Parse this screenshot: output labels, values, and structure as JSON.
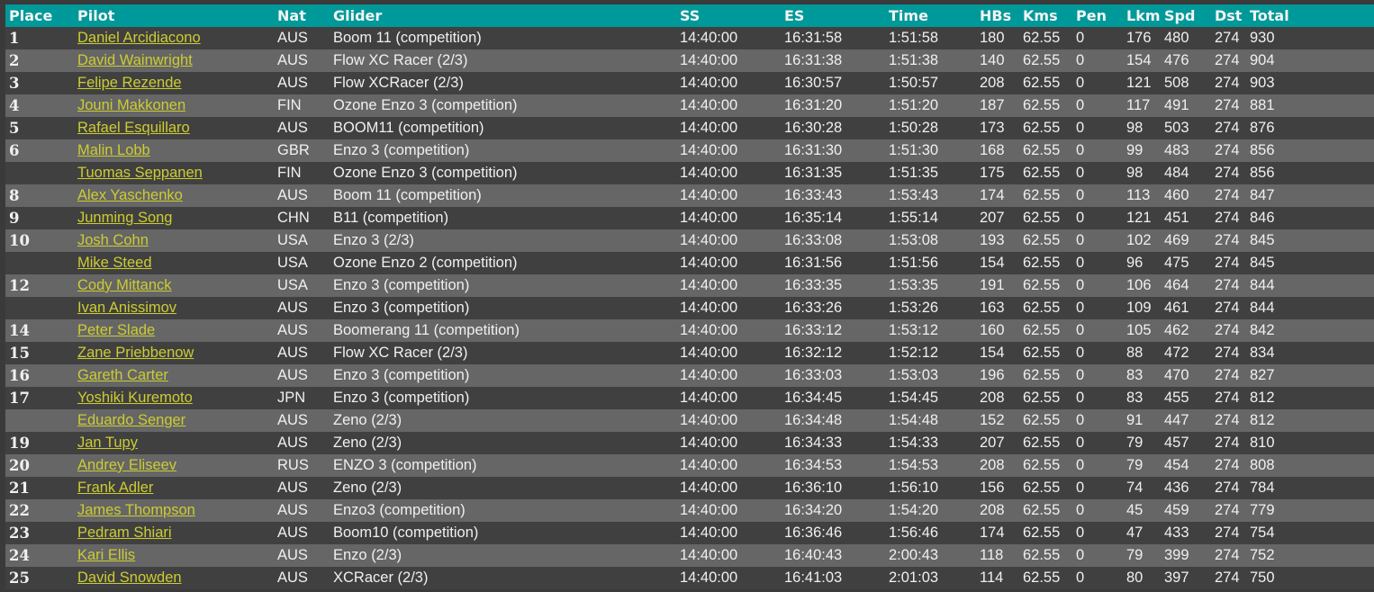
{
  "colors": {
    "header_bg": "#009999",
    "row_dark": "#404040",
    "row_light": "#666666",
    "link": "#cccc33",
    "text": "#f0f0f0"
  },
  "columns": [
    "Place",
    "Pilot",
    "Nat",
    "Glider",
    "SS",
    "ES",
    "Time",
    "HBs",
    "Kms",
    "Pen",
    "Lkm",
    "Spd",
    "Dst",
    "Total"
  ],
  "rows": [
    {
      "place": "1",
      "pilot": "Daniel Arcidiacono",
      "nat": "AUS",
      "glider": "Boom 11 (competition)",
      "ss": "14:40:00",
      "es": "16:31:58",
      "time": "1:51:58",
      "hbs": "180",
      "kms": "62.55",
      "pen": "0",
      "lkm": "176",
      "spd": "480",
      "dst": "274",
      "total": "930"
    },
    {
      "place": "2",
      "pilot": "David Wainwright",
      "nat": "AUS",
      "glider": "Flow XC Racer (2/3)",
      "ss": "14:40:00",
      "es": "16:31:38",
      "time": "1:51:38",
      "hbs": "140",
      "kms": "62.55",
      "pen": "0",
      "lkm": "154",
      "spd": "476",
      "dst": "274",
      "total": "904"
    },
    {
      "place": "3",
      "pilot": "Felipe Rezende",
      "nat": "AUS",
      "glider": "Flow XCRacer (2/3)",
      "ss": "14:40:00",
      "es": "16:30:57",
      "time": "1:50:57",
      "hbs": "208",
      "kms": "62.55",
      "pen": "0",
      "lkm": "121",
      "spd": "508",
      "dst": "274",
      "total": "903"
    },
    {
      "place": "4",
      "pilot": "Jouni Makkonen",
      "nat": "FIN",
      "glider": "Ozone Enzo 3 (competition)",
      "ss": "14:40:00",
      "es": "16:31:20",
      "time": "1:51:20",
      "hbs": "187",
      "kms": "62.55",
      "pen": "0",
      "lkm": "117",
      "spd": "491",
      "dst": "274",
      "total": "881"
    },
    {
      "place": "5",
      "pilot": "Rafael Esquillaro",
      "nat": "AUS",
      "glider": "BOOM11 (competition)",
      "ss": "14:40:00",
      "es": "16:30:28",
      "time": "1:50:28",
      "hbs": "173",
      "kms": "62.55",
      "pen": "0",
      "lkm": "98",
      "spd": "503",
      "dst": "274",
      "total": "876"
    },
    {
      "place": "6",
      "pilot": "Malin Lobb",
      "nat": "GBR",
      "glider": "Enzo 3 (competition)",
      "ss": "14:40:00",
      "es": "16:31:30",
      "time": "1:51:30",
      "hbs": "168",
      "kms": "62.55",
      "pen": "0",
      "lkm": "99",
      "spd": "483",
      "dst": "274",
      "total": "856"
    },
    {
      "place": "",
      "pilot": "Tuomas Seppanen",
      "nat": "FIN",
      "glider": "Ozone Enzo 3 (competition)",
      "ss": "14:40:00",
      "es": "16:31:35",
      "time": "1:51:35",
      "hbs": "175",
      "kms": "62.55",
      "pen": "0",
      "lkm": "98",
      "spd": "484",
      "dst": "274",
      "total": "856"
    },
    {
      "place": "8",
      "pilot": "Alex Yaschenko",
      "nat": "AUS",
      "glider": "Boom 11 (competition)",
      "ss": "14:40:00",
      "es": "16:33:43",
      "time": "1:53:43",
      "hbs": "174",
      "kms": "62.55",
      "pen": "0",
      "lkm": "113",
      "spd": "460",
      "dst": "274",
      "total": "847"
    },
    {
      "place": "9",
      "pilot": "Junming Song",
      "nat": "CHN",
      "glider": "B11 (competition)",
      "ss": "14:40:00",
      "es": "16:35:14",
      "time": "1:55:14",
      "hbs": "207",
      "kms": "62.55",
      "pen": "0",
      "lkm": "121",
      "spd": "451",
      "dst": "274",
      "total": "846"
    },
    {
      "place": "10",
      "pilot": "Josh Cohn",
      "nat": "USA",
      "glider": "Enzo 3 (2/3)",
      "ss": "14:40:00",
      "es": "16:33:08",
      "time": "1:53:08",
      "hbs": "193",
      "kms": "62.55",
      "pen": "0",
      "lkm": "102",
      "spd": "469",
      "dst": "274",
      "total": "845"
    },
    {
      "place": "",
      "pilot": "Mike Steed",
      "nat": "USA",
      "glider": "Ozone Enzo 2 (competition)",
      "ss": "14:40:00",
      "es": "16:31:56",
      "time": "1:51:56",
      "hbs": "154",
      "kms": "62.55",
      "pen": "0",
      "lkm": "96",
      "spd": "475",
      "dst": "274",
      "total": "845"
    },
    {
      "place": "12",
      "pilot": "Cody Mittanck",
      "nat": "USA",
      "glider": "Enzo 3 (competition)",
      "ss": "14:40:00",
      "es": "16:33:35",
      "time": "1:53:35",
      "hbs": "191",
      "kms": "62.55",
      "pen": "0",
      "lkm": "106",
      "spd": "464",
      "dst": "274",
      "total": "844"
    },
    {
      "place": "",
      "pilot": "Ivan Anissimov",
      "nat": "AUS",
      "glider": "Enzo 3 (competition)",
      "ss": "14:40:00",
      "es": "16:33:26",
      "time": "1:53:26",
      "hbs": "163",
      "kms": "62.55",
      "pen": "0",
      "lkm": "109",
      "spd": "461",
      "dst": "274",
      "total": "844"
    },
    {
      "place": "14",
      "pilot": "Peter Slade",
      "nat": "AUS",
      "glider": "Boomerang 11 (competition)",
      "ss": "14:40:00",
      "es": "16:33:12",
      "time": "1:53:12",
      "hbs": "160",
      "kms": "62.55",
      "pen": "0",
      "lkm": "105",
      "spd": "462",
      "dst": "274",
      "total": "842"
    },
    {
      "place": "15",
      "pilot": "Zane Priebbenow",
      "nat": "AUS",
      "glider": "Flow XC Racer (2/3)",
      "ss": "14:40:00",
      "es": "16:32:12",
      "time": "1:52:12",
      "hbs": "154",
      "kms": "62.55",
      "pen": "0",
      "lkm": "88",
      "spd": "472",
      "dst": "274",
      "total": "834"
    },
    {
      "place": "16",
      "pilot": "Gareth Carter",
      "nat": "AUS",
      "glider": "Enzo 3 (competition)",
      "ss": "14:40:00",
      "es": "16:33:03",
      "time": "1:53:03",
      "hbs": "196",
      "kms": "62.55",
      "pen": "0",
      "lkm": "83",
      "spd": "470",
      "dst": "274",
      "total": "827"
    },
    {
      "place": "17",
      "pilot": "Yoshiki Kuremoto",
      "nat": "JPN",
      "glider": "Enzo 3 (competition)",
      "ss": "14:40:00",
      "es": "16:34:45",
      "time": "1:54:45",
      "hbs": "208",
      "kms": "62.55",
      "pen": "0",
      "lkm": "83",
      "spd": "455",
      "dst": "274",
      "total": "812"
    },
    {
      "place": "",
      "pilot": "Eduardo Senger",
      "nat": "AUS",
      "glider": "Zeno (2/3)",
      "ss": "14:40:00",
      "es": "16:34:48",
      "time": "1:54:48",
      "hbs": "152",
      "kms": "62.55",
      "pen": "0",
      "lkm": "91",
      "spd": "447",
      "dst": "274",
      "total": "812"
    },
    {
      "place": "19",
      "pilot": "Jan Tupy",
      "nat": "AUS",
      "glider": "Zeno (2/3)",
      "ss": "14:40:00",
      "es": "16:34:33",
      "time": "1:54:33",
      "hbs": "207",
      "kms": "62.55",
      "pen": "0",
      "lkm": "79",
      "spd": "457",
      "dst": "274",
      "total": "810"
    },
    {
      "place": "20",
      "pilot": "Andrey Eliseev",
      "nat": "RUS",
      "glider": "ENZO 3 (competition)",
      "ss": "14:40:00",
      "es": "16:34:53",
      "time": "1:54:53",
      "hbs": "208",
      "kms": "62.55",
      "pen": "0",
      "lkm": "79",
      "spd": "454",
      "dst": "274",
      "total": "808"
    },
    {
      "place": "21",
      "pilot": "Frank Adler",
      "nat": "AUS",
      "glider": "Zeno (2/3)",
      "ss": "14:40:00",
      "es": "16:36:10",
      "time": "1:56:10",
      "hbs": "156",
      "kms": "62.55",
      "pen": "0",
      "lkm": "74",
      "spd": "436",
      "dst": "274",
      "total": "784"
    },
    {
      "place": "22",
      "pilot": "James Thompson",
      "nat": "AUS",
      "glider": "Enzo3 (competition)",
      "ss": "14:40:00",
      "es": "16:34:20",
      "time": "1:54:20",
      "hbs": "208",
      "kms": "62.55",
      "pen": "0",
      "lkm": "45",
      "spd": "459",
      "dst": "274",
      "total": "779"
    },
    {
      "place": "23",
      "pilot": "Pedram Shiari",
      "nat": "AUS",
      "glider": "Boom10 (competition)",
      "ss": "14:40:00",
      "es": "16:36:46",
      "time": "1:56:46",
      "hbs": "174",
      "kms": "62.55",
      "pen": "0",
      "lkm": "47",
      "spd": "433",
      "dst": "274",
      "total": "754"
    },
    {
      "place": "24",
      "pilot": "Kari Ellis",
      "nat": "AUS",
      "glider": "Enzo (2/3)",
      "ss": "14:40:00",
      "es": "16:40:43",
      "time": "2:00:43",
      "hbs": "118",
      "kms": "62.55",
      "pen": "0",
      "lkm": "79",
      "spd": "399",
      "dst": "274",
      "total": "752"
    },
    {
      "place": "25",
      "pilot": "David Snowden",
      "nat": "AUS",
      "glider": "XCRacer (2/3)",
      "ss": "14:40:00",
      "es": "16:41:03",
      "time": "2:01:03",
      "hbs": "114",
      "kms": "62.55",
      "pen": "0",
      "lkm": "80",
      "spd": "397",
      "dst": "274",
      "total": "750"
    }
  ]
}
